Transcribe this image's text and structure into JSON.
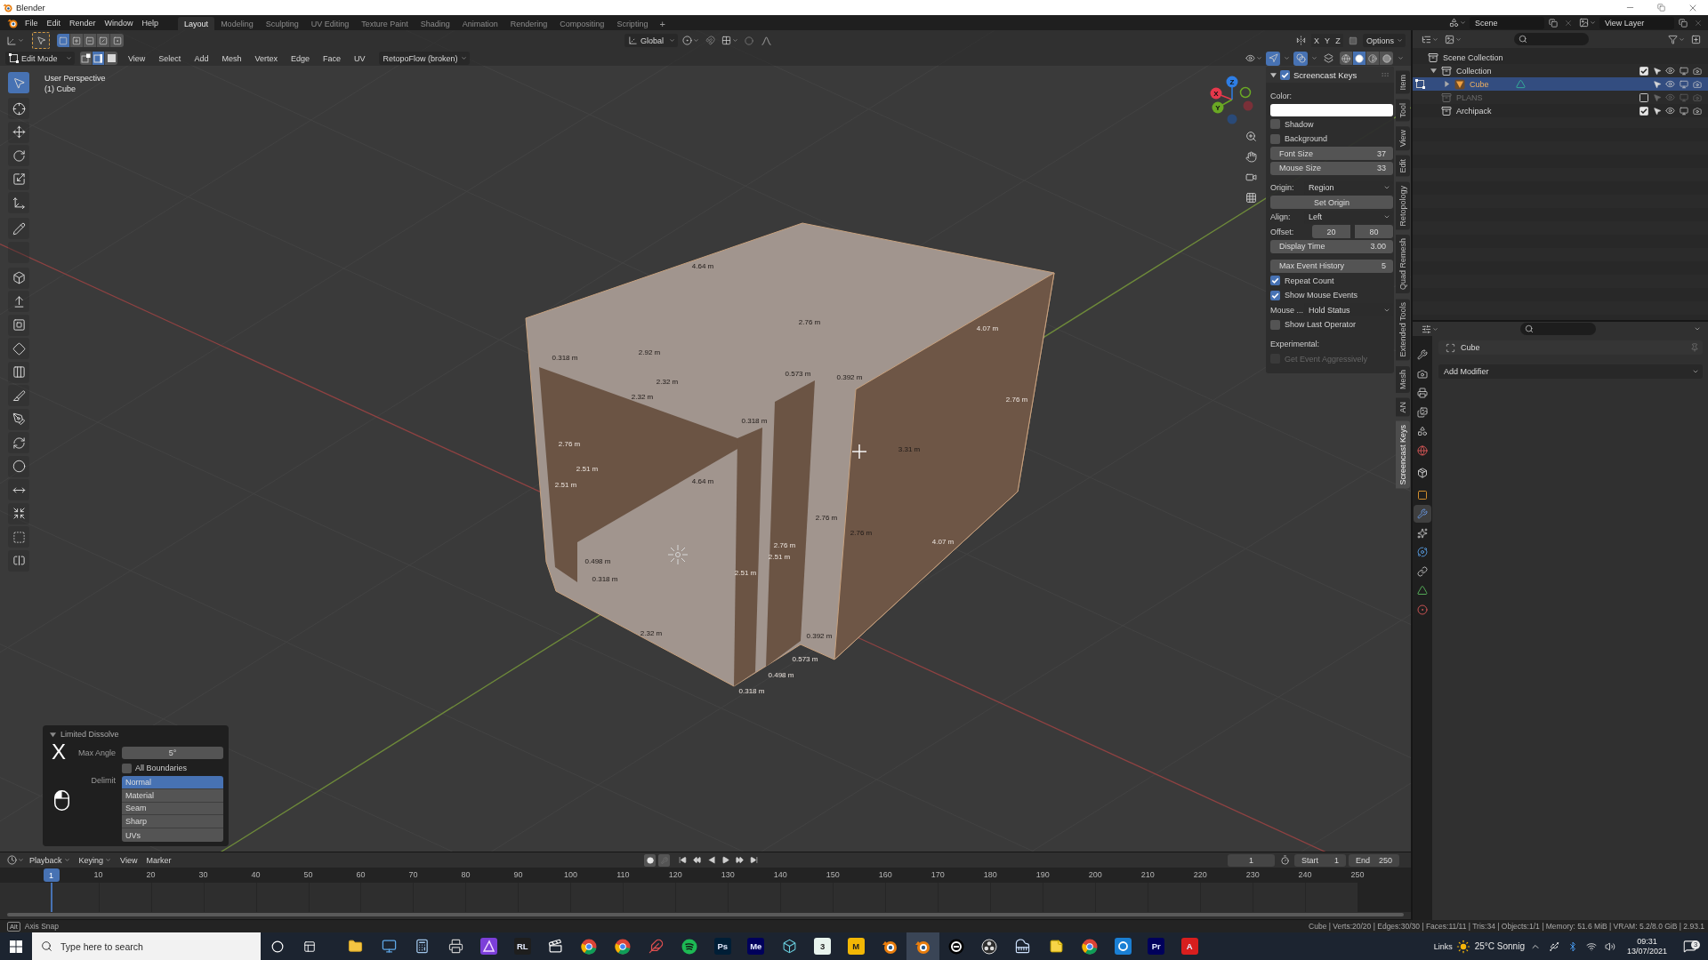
{
  "window": {
    "title": "Blender"
  },
  "top_bar": {
    "menus": [
      "File",
      "Edit",
      "Render",
      "Window",
      "Help"
    ],
    "workspaces": [
      {
        "label": "Layout",
        "selected": true
      },
      {
        "label": "Modeling",
        "selected": false
      },
      {
        "label": "Sculpting",
        "selected": false
      },
      {
        "label": "UV Editing",
        "selected": false
      },
      {
        "label": "Texture Paint",
        "selected": false
      },
      {
        "label": "Shading",
        "selected": false
      },
      {
        "label": "Animation",
        "selected": false
      },
      {
        "label": "Rendering",
        "selected": false
      },
      {
        "label": "Compositing",
        "selected": false
      },
      {
        "label": "Scripting",
        "selected": false
      }
    ],
    "add_workspace": "+",
    "scene": "Scene",
    "view_layer": "View Layer"
  },
  "viewport": {
    "tool_header": {
      "select_ops": [
        {
          "kind": "set",
          "selected": true
        },
        {
          "kind": "extend",
          "selected": false
        },
        {
          "kind": "subtract",
          "selected": false
        },
        {
          "kind": "invert",
          "selected": false
        },
        {
          "kind": "intersect",
          "selected": false
        }
      ],
      "orientation": "Global",
      "mirror_axes": [
        {
          "label": "X",
          "on": false
        },
        {
          "label": "Y",
          "on": false
        },
        {
          "label": "Z",
          "on": false
        }
      ],
      "options": "Options"
    },
    "header": {
      "mode": "Edit Mode",
      "select_modes": [
        {
          "kind": "vertex",
          "selected": false
        },
        {
          "kind": "edge",
          "selected": true
        },
        {
          "kind": "face",
          "selected": false
        }
      ],
      "menus": [
        "View",
        "Select",
        "Add",
        "Mesh",
        "Vertex",
        "Edge",
        "Face",
        "UV"
      ],
      "addon_menu": "RetopoFlow (broken)",
      "toggles": [
        {
          "kind": "gizmos",
          "on": true
        },
        {
          "kind": "overlays",
          "on": true
        },
        {
          "kind": "xray",
          "on": false
        }
      ],
      "shading": [
        {
          "kind": "wireframe",
          "selected": false
        },
        {
          "kind": "solid",
          "selected": true
        },
        {
          "kind": "material",
          "selected": false
        },
        {
          "kind": "rendered",
          "selected": false
        }
      ]
    },
    "view_name": "User Perspective",
    "object_name": "(1) Cube",
    "tool_groups": [
      [
        {
          "kind": "select",
          "selected": true
        }
      ],
      [
        {
          "kind": "cursor",
          "selected": false
        },
        {
          "kind": "move",
          "selected": false
        },
        {
          "kind": "rotate",
          "selected": false
        },
        {
          "kind": "scale",
          "selected": false
        },
        {
          "kind": "transform",
          "selected": false
        }
      ],
      [
        {
          "kind": "annotate",
          "selected": false
        },
        {
          "kind": "measure",
          "selected": false
        }
      ],
      [
        {
          "kind": "add-cube",
          "selected": false
        },
        {
          "kind": "extrude",
          "selected": false
        },
        {
          "kind": "inset",
          "selected": false
        },
        {
          "kind": "bevel",
          "selected": false
        },
        {
          "kind": "loop-cut",
          "selected": false
        },
        {
          "kind": "knife",
          "selected": false
        },
        {
          "kind": "poly-build",
          "selected": false
        },
        {
          "kind": "spin",
          "selected": false
        },
        {
          "kind": "smooth",
          "selected": false
        },
        {
          "kind": "edge-slide",
          "selected": false
        },
        {
          "kind": "shrink",
          "selected": false
        },
        {
          "kind": "shear",
          "selected": false
        },
        {
          "kind": "rip",
          "selected": false
        }
      ]
    ],
    "gizmo_axes": [
      "X",
      "Y",
      "Z"
    ],
    "measurements": [
      "4.64 m",
      "2.76 m",
      "4.07 m",
      "0.318 m",
      "2.92 m",
      "2.32 m",
      "0.573 m",
      "0.392 m",
      "2.32 m",
      "2.76 m",
      "0.318 m",
      "2.76 m",
      "3.31 m",
      "2.51 m",
      "2.51 m",
      "4.64 m",
      "2.76 m",
      "2.76 m",
      "2.76 m",
      "4.07 m",
      "0.498 m",
      "2.51 m",
      "0.318 m",
      "2.51 m",
      "2.32 m",
      "0.392 m",
      "0.573 m",
      "0.498 m",
      "0.318 m"
    ],
    "sidebar": {
      "tabs": [
        {
          "label": "Item",
          "selected": false
        },
        {
          "label": "Tool",
          "selected": false
        },
        {
          "label": "View",
          "selected": false
        },
        {
          "label": "Edit",
          "selected": false
        },
        {
          "label": "Retopology",
          "selected": false
        },
        {
          "label": "Quad Remesh",
          "selected": false
        },
        {
          "label": "Extended Tools",
          "selected": false
        },
        {
          "label": "Mesh",
          "selected": false
        },
        {
          "label": "AN",
          "selected": false
        },
        {
          "label": "Screencast Keys",
          "selected": true
        }
      ],
      "panel": {
        "title": "Screencast Keys",
        "enabled": true,
        "expanded": true,
        "groups": [
          [
            {
              "kind": "color",
              "label": "Color:",
              "color": "#ffffff"
            },
            {
              "kind": "checkbox",
              "label": "Shadow",
              "checked": false,
              "disabled": false
            },
            {
              "kind": "checkbox",
              "label": "Background",
              "checked": false,
              "disabled": false
            },
            {
              "kind": "number",
              "label": "Font Size",
              "value": "37"
            },
            {
              "kind": "number",
              "label": "Mouse Size",
              "value": "33"
            }
          ],
          [
            {
              "kind": "dropdown",
              "label": "Origin:",
              "value": "Region"
            },
            {
              "kind": "button",
              "label": "Set Origin"
            },
            {
              "kind": "dropdown",
              "label": "Align:",
              "value": "Left"
            },
            {
              "kind": "pair",
              "label": "Offset:",
              "values": [
                "20",
                "80"
              ]
            },
            {
              "kind": "number",
              "label": "Display Time",
              "value": "3.00"
            }
          ],
          [
            {
              "kind": "number",
              "label": "Max Event History",
              "value": "5"
            },
            {
              "kind": "checkbox",
              "label": "Repeat Count",
              "checked": true,
              "disabled": false
            },
            {
              "kind": "checkbox",
              "label": "Show Mouse Events",
              "checked": true,
              "disabled": false
            },
            {
              "kind": "dropdown",
              "label": "Mouse ...",
              "value": "Hold Status"
            },
            {
              "kind": "checkbox",
              "label": "Show Last Operator",
              "checked": false,
              "disabled": false
            }
          ],
          [
            {
              "kind": "heading",
              "label": "Experimental:"
            },
            {
              "kind": "checkbox",
              "label": "Get Event Aggressively",
              "checked": false,
              "disabled": true
            }
          ]
        ]
      }
    },
    "last_operator": {
      "title": "Limited Dissolve",
      "expanded": true,
      "max_angle_label": "Max Angle",
      "max_angle": "5°",
      "all_boundaries": {
        "label": "All Boundaries",
        "checked": false
      },
      "delimit_label": "Delimit",
      "delimit": [
        {
          "label": "Normal",
          "selected": true
        },
        {
          "label": "Material",
          "selected": false
        },
        {
          "label": "Seam",
          "selected": false
        },
        {
          "label": "Sharp",
          "selected": false
        },
        {
          "label": "UVs",
          "selected": false
        }
      ]
    },
    "screencast": {
      "key": "X"
    }
  },
  "outliner": {
    "tree": [
      {
        "label": "Scene Collection",
        "kind": "scene",
        "selected": false,
        "children": [
          {
            "label": "Collection",
            "kind": "collection",
            "selected": false,
            "expanded": true,
            "checked": true,
            "children": [
              {
                "label": "Cube",
                "kind": "mesh",
                "selected": true,
                "expanded": false
              }
            ]
          },
          {
            "label": "PLANS",
            "kind": "collection",
            "selected": false,
            "checked": false
          },
          {
            "label": "Archipack",
            "kind": "collection",
            "selected": false,
            "checked": true
          }
        ]
      }
    ]
  },
  "properties": {
    "tab_groups": [
      [
        {
          "kind": "tool",
          "selected": false
        },
        {
          "kind": "render",
          "selected": false
        },
        {
          "kind": "output",
          "selected": false
        },
        {
          "kind": "view-layer",
          "selected": false
        },
        {
          "kind": "scene",
          "selected": false
        },
        {
          "kind": "world",
          "selected": false
        }
      ],
      [
        {
          "kind": "collection",
          "selected": false
        }
      ],
      [
        {
          "kind": "object",
          "selected": false
        },
        {
          "kind": "modifiers",
          "selected": true
        },
        {
          "kind": "particles",
          "selected": false
        },
        {
          "kind": "physics",
          "selected": false
        },
        {
          "kind": "constraints",
          "selected": false
        },
        {
          "kind": "data",
          "selected": false
        },
        {
          "kind": "material",
          "selected": false
        }
      ]
    ],
    "object": "Cube",
    "add_modifier": "Add Modifier"
  },
  "timeline": {
    "menus": [
      {
        "label": "Playback",
        "kind": "dropdown"
      },
      {
        "label": "Keying",
        "kind": "dropdown"
      },
      {
        "label": "View",
        "kind": "menu"
      },
      {
        "label": "Marker",
        "kind": "menu"
      }
    ],
    "current_frame": "1",
    "start_label": "Start",
    "start": "1",
    "end_label": "End",
    "end": "250",
    "playhead": "1",
    "ticks": [
      "10",
      "20",
      "30",
      "40",
      "50",
      "60",
      "70",
      "80",
      "90",
      "100",
      "110",
      "120",
      "130",
      "140",
      "150",
      "160",
      "170",
      "180",
      "190",
      "200",
      "210",
      "220",
      "230",
      "240",
      "250"
    ]
  },
  "status_bar": {
    "key": "Alt",
    "hint": "Axis Snap",
    "stats": "Cube | Verts:20/20 | Edges:30/30 | Faces:11/11 | Tris:34 | Objects:1/1 | Memory: 51.6 MiB | VRAM: 5.2/8.0 GiB | 2.93.1"
  },
  "taskbar": {
    "search_placeholder": "Type here to search",
    "apps": [
      {
        "kind": "folder",
        "selected": false
      },
      {
        "kind": "monitor",
        "selected": false
      },
      {
        "kind": "calculator",
        "selected": false
      },
      {
        "kind": "printer",
        "selected": false
      },
      {
        "kind": "triangle-tile",
        "selected": false
      },
      {
        "kind": "letter-tile",
        "label": "RL",
        "color": "#1e1e1e",
        "selected": false
      },
      {
        "kind": "clapperboard",
        "selected": false
      },
      {
        "kind": "round-logo",
        "selected": false
      },
      {
        "kind": "round-logo",
        "selected": false
      },
      {
        "kind": "feather",
        "selected": false
      },
      {
        "kind": "wave-circle",
        "selected": false
      },
      {
        "kind": "letter-tile",
        "label": "Ps",
        "color": "#001e36",
        "selected": false
      },
      {
        "kind": "letter-tile",
        "label": "Me",
        "color": "#00005b",
        "selected": false
      },
      {
        "kind": "cube",
        "selected": false
      },
      {
        "kind": "letter-tile",
        "label": "3",
        "color": "#e8f4ee",
        "selected": false
      },
      {
        "kind": "letter-tile",
        "label": "M",
        "color": "#f2b705",
        "selected": false
      },
      {
        "kind": "orbit-logo",
        "selected": false
      },
      {
        "kind": "orbit-logo",
        "selected": true
      },
      {
        "kind": "ring-logo",
        "selected": false
      },
      {
        "kind": "circle-logo",
        "selected": false
      },
      {
        "kind": "piano",
        "selected": false
      },
      {
        "kind": "sticky-note",
        "selected": false
      },
      {
        "kind": "round-logo",
        "selected": false
      },
      {
        "kind": "square-logo",
        "selected": false
      },
      {
        "kind": "letter-tile",
        "label": "Pr",
        "color": "#00005b",
        "selected": false
      },
      {
        "kind": "letter-tile",
        "label": "A",
        "color": "#d81e1e",
        "selected": false
      }
    ],
    "links": "Links",
    "weather": "25°C Sonnig",
    "time": "09:31",
    "date": "13/07/2021",
    "notifications": "3"
  }
}
